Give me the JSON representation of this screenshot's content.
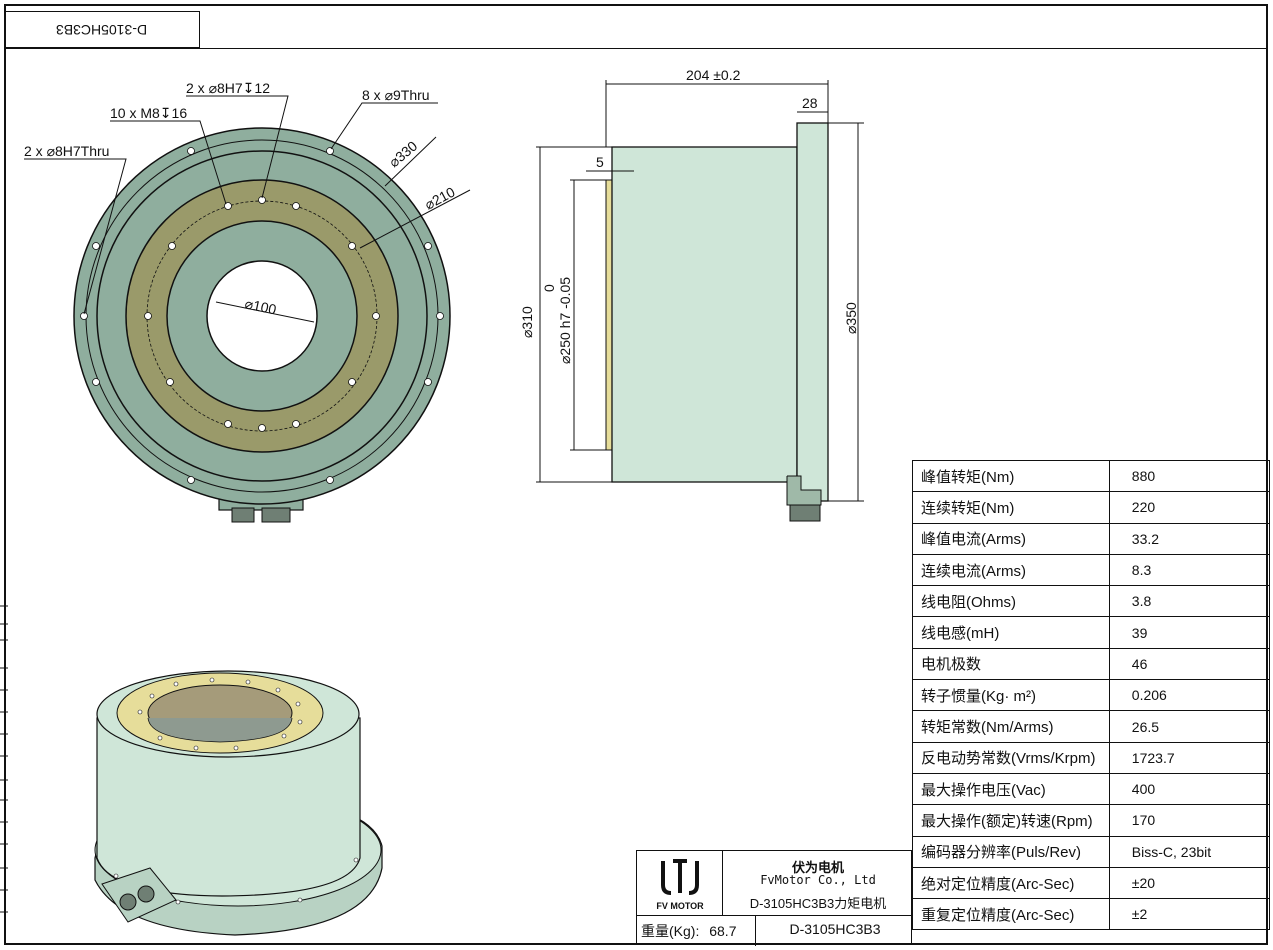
{
  "drawing_code": "D-3105HC3B3",
  "front_view": {
    "callouts": {
      "holes_8h7_thru": "2 x ⌀8H7Thru",
      "tapped_m8": "10 x M8↧16",
      "dowel_8h7": "2 x ⌀8H7↧12",
      "holes_9_thru": "8 x ⌀9Thru",
      "dia_330": "⌀330",
      "dia_210": "⌀210",
      "dia_100": "⌀100"
    }
  },
  "side_view": {
    "dims": {
      "length": "204 ±0.2",
      "flange": "28",
      "step": "5",
      "dia_310": "⌀310",
      "dia_250": "⌀250 h7 -0.05",
      "dia_250_tol_upper": "0",
      "dia_350": "⌀350"
    }
  },
  "specs": [
    {
      "label": "峰值转矩(Nm)",
      "value": "880"
    },
    {
      "label": "连续转矩(Nm)",
      "value": "220"
    },
    {
      "label": "峰值电流(Arms)",
      "value": "33.2"
    },
    {
      "label": "连续电流(Arms)",
      "value": "8.3"
    },
    {
      "label": "线电阻(Ohms)",
      "value": "3.8"
    },
    {
      "label": "线电感(mH)",
      "value": "39"
    },
    {
      "label": "电机极数",
      "value": "46"
    },
    {
      "label": "转子惯量(Kg· m²)",
      "value": "0.206"
    },
    {
      "label": "转矩常数(Nm/Arms)",
      "value": "26.5"
    },
    {
      "label": "反电动势常数(Vrms/Krpm)",
      "value": "1723.7"
    },
    {
      "label": "最大操作电压(Vac)",
      "value": "400"
    },
    {
      "label": "最大操作(额定)转速(Rpm)",
      "value": "170"
    },
    {
      "label": "编码器分辨率(Puls/Rev)",
      "value": "Biss-C, 23bit"
    },
    {
      "label": "绝对定位精度(Arc-Sec)",
      "value": "±20"
    },
    {
      "label": "重复定位精度(Arc-Sec)",
      "value": "±2"
    }
  ],
  "title_block": {
    "company_cn": "伏为电机",
    "company_en": "FvMotor Co., Ltd",
    "product_title": "D-3105HC3B3力矩电机",
    "logo_text": "FV MOTOR",
    "weight_label": "重量(Kg):",
    "weight_value": "68.7",
    "model": "D-3105HC3B3"
  },
  "colors": {
    "housing": "#8fae9e",
    "housing_light": "#cfe6d8",
    "rotor_ring": "#9a9a6a",
    "rotor_ring_3d": "#e6dd9a",
    "line": "#111111"
  }
}
